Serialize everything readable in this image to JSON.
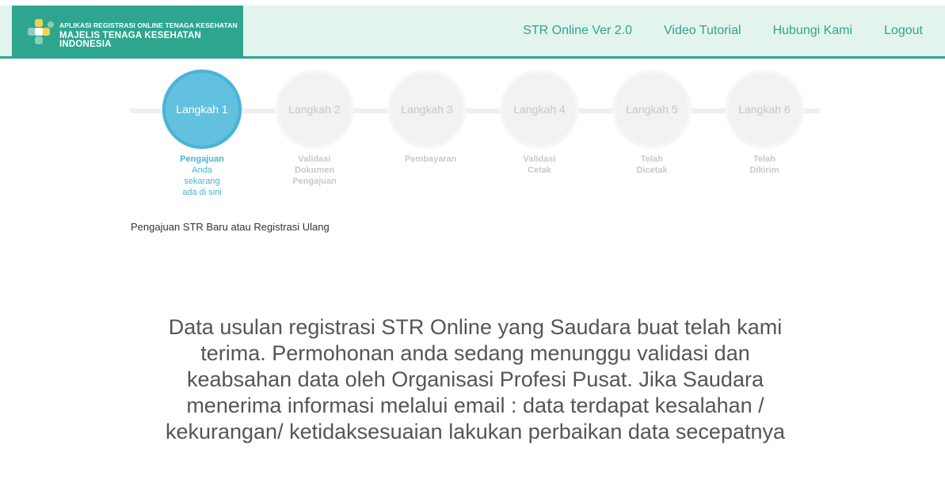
{
  "brand": {
    "line1": "APLIKASI REGISTRASI ONLINE TENAGA KESEHATAN",
    "line2": "MAJELIS TENAGA KESEHATAN INDONESIA",
    "logo_icon": "mtki-logo-icon",
    "color": "#2ea58f"
  },
  "nav": {
    "items": [
      {
        "label": "STR Online Ver 2.0"
      },
      {
        "label": "Video Tutorial"
      },
      {
        "label": "Hubungi Kami"
      },
      {
        "label": "Logout"
      }
    ]
  },
  "steps": [
    {
      "title": "Langkah 1",
      "label": "Pengajuan",
      "sub": "Anda sekarang ada di sini",
      "active": true
    },
    {
      "title": "Langkah 2",
      "label": "Validasi Dokumen Pengajuan",
      "active": false
    },
    {
      "title": "Langkah 3",
      "label": "Pembayaran",
      "active": false
    },
    {
      "title": "Langkah 4",
      "label": "Validasi Cetak",
      "active": false
    },
    {
      "title": "Langkah 5",
      "label": "Telah Dicetak",
      "active": false
    },
    {
      "title": "Langkah 6",
      "label": "Telah Dikirim",
      "active": false
    }
  ],
  "accent_active": "#4ab3d5",
  "section_title": "Pengajuan STR Baru atau Registrasi Ulang",
  "message": "Data usulan registrasi STR Online yang Saudara buat telah kami terima. Permohonan anda sedang menunggu validasi dan keabsahan data oleh Organisasi Profesi Pusat. Jika Saudara menerima informasi melalui email : data terdapat kesalahan / kekurangan/ ketidaksesuaian lakukan perbaikan data secepatnya"
}
